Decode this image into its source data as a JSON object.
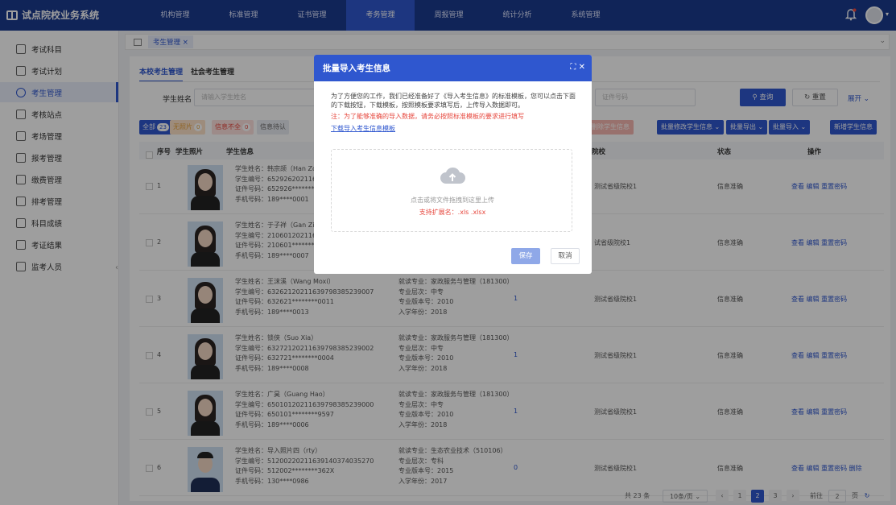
{
  "app": {
    "title": "试点院校业务系统"
  },
  "nav": [
    "机构管理",
    "标准管理",
    "证书管理",
    "考务管理",
    "周报管理",
    "统计分析",
    "系统管理"
  ],
  "nav_active": 3,
  "sidebar": [
    {
      "label": "考试科目"
    },
    {
      "label": "考试计划"
    },
    {
      "label": "考生管理"
    },
    {
      "label": "考核站点"
    },
    {
      "label": "考场管理"
    },
    {
      "label": "报考管理"
    },
    {
      "label": "缴费管理"
    },
    {
      "label": "排考管理"
    },
    {
      "label": "科目成绩"
    },
    {
      "label": "考证结果"
    },
    {
      "label": "监考人员"
    }
  ],
  "sidebar_active": 2,
  "breadcrumb": {
    "tab": "考生管理"
  },
  "tabs": [
    "本校考生管理",
    "社会考生管理"
  ],
  "search": {
    "name_label": "学生姓名",
    "name_placeholder": "请输入学生姓名",
    "id_placeholder": "证件号码",
    "query": "查询",
    "reset": "重置",
    "expand": "展开"
  },
  "filters": [
    {
      "label": "全部",
      "count": "23",
      "bg": "#2f57cf",
      "fg": "#ffffff"
    },
    {
      "label": "无照片",
      "count": "0",
      "bg": "#fde3c8",
      "fg": "#e6a23c"
    },
    {
      "label": "信息不全",
      "count": "0",
      "bg": "#fde0de",
      "fg": "#e6463c"
    },
    {
      "label": "信息待认",
      "count": "",
      "bg": "#e9ecf2",
      "fg": "#666666"
    }
  ],
  "actions": {
    "batch_delete": "批量删除学生信息",
    "batch_edit": "批量修改学生信息",
    "batch_export": "批量导出",
    "batch_import": "批量导入",
    "add": "新增学生信息"
  },
  "table": {
    "headers": [
      "序号",
      "学生照片",
      "学生信息",
      "院校",
      "状态",
      "操作"
    ]
  },
  "rows": [
    {
      "idx": "1",
      "name": "学生姓名：韩宗颉（Han Zong",
      "no": "学生编号：65292620211639",
      "cert": "证件号码：652926********15",
      "phone": "手机号码：189****0001",
      "major": "",
      "level": "",
      "ver": "",
      "year": "",
      "num": "",
      "school": "测试省级院校1",
      "status": "信息准确",
      "ops": "查看 编辑 重置密码"
    },
    {
      "idx": "2",
      "name": "学生姓名：于子祥（Gan Zixi",
      "no": "学生编号：21060120211639",
      "cert": "证件号码：210601********28",
      "phone": "手机号码：189****0007",
      "major": "",
      "level": "",
      "ver": "",
      "year": "",
      "num": "",
      "school": "试省级院校1",
      "status": "信息准确",
      "ops": "查看 编辑 重置密码"
    },
    {
      "idx": "3",
      "name": "学生姓名：王沫溪（Wang Moxi）",
      "no": "学生编号：632621202116397983852390​07",
      "cert": "证件号码：632621********0011",
      "phone": "手机号码：189****0013",
      "major": "就读专业：家政服务与管理（181300）",
      "level": "专业层次：中专",
      "ver": "专业版本号：2010",
      "year": "入学年份：2018",
      "num": "1",
      "school": "测试省级院校1",
      "status": "信息准确",
      "ops": "查看 编辑 重置密码"
    },
    {
      "idx": "4",
      "name": "学生姓名：锁侠（Suo Xia）",
      "no": "学生编号：63272120211639798385239002",
      "cert": "证件号码：632721********0004",
      "phone": "手机号码：189****0008",
      "major": "就读专业：家政服务与管理（181300）",
      "level": "专业层次：中专",
      "ver": "专业版本号：2010",
      "year": "入学年份：2018",
      "num": "1",
      "school": "测试省级院校1",
      "status": "信息准确",
      "ops": "查看 编辑 重置密码"
    },
    {
      "idx": "5",
      "name": "学生姓名：广昊（Guang Hao）",
      "no": "学生编号：65010120211639798385239000",
      "cert": "证件号码：650101********9597",
      "phone": "手机号码：189****0006",
      "major": "就读专业：家政服务与管理（181300）",
      "level": "专业层次：中专",
      "ver": "专业版本号：2010",
      "year": "入学年份：2018",
      "num": "1",
      "school": "测试省级院校1",
      "status": "信息准确",
      "ops": "查看 编辑 重置密码"
    },
    {
      "idx": "6",
      "name": "学生姓名：导入照片四（rty）",
      "no": "学生编号：51200220211639140374035270",
      "cert": "证件号码：512002********362X",
      "phone": "手机号码：130****0986",
      "major": "就读专业：生态农业技术（510106）",
      "level": "专业层次：专科",
      "ver": "专业版本号：2015",
      "year": "入学年份：2017",
      "num": "0",
      "school": "测试省级院校1",
      "status": "信息准确",
      "ops": "查看 编辑 重置密码 删除"
    }
  ],
  "pager": {
    "total": "共 23 条",
    "size": "10条/页",
    "pages": [
      "1",
      "2",
      "3"
    ],
    "current": "2",
    "goto_label": "前往",
    "goto_value": "2",
    "unit": "页"
  },
  "modal": {
    "title": "批量导入考生信息",
    "intro": "为了方便您的工作，我们已经准备好了《导入考生信息》的标准模板，您可以点击下面的下载按钮，下载模板，按照模板要求填写后，上传导入数据即可。",
    "warn": "注：为了能够准确的导入数据，请务必按照标准模板的要求进行填写",
    "link": "下载导入考生信息模板",
    "upload_hint": "点击或将文件拖拽到这里上传",
    "ext_hint": "支持扩展名：.xls .xlsx",
    "save": "保存",
    "cancel": "取消"
  }
}
